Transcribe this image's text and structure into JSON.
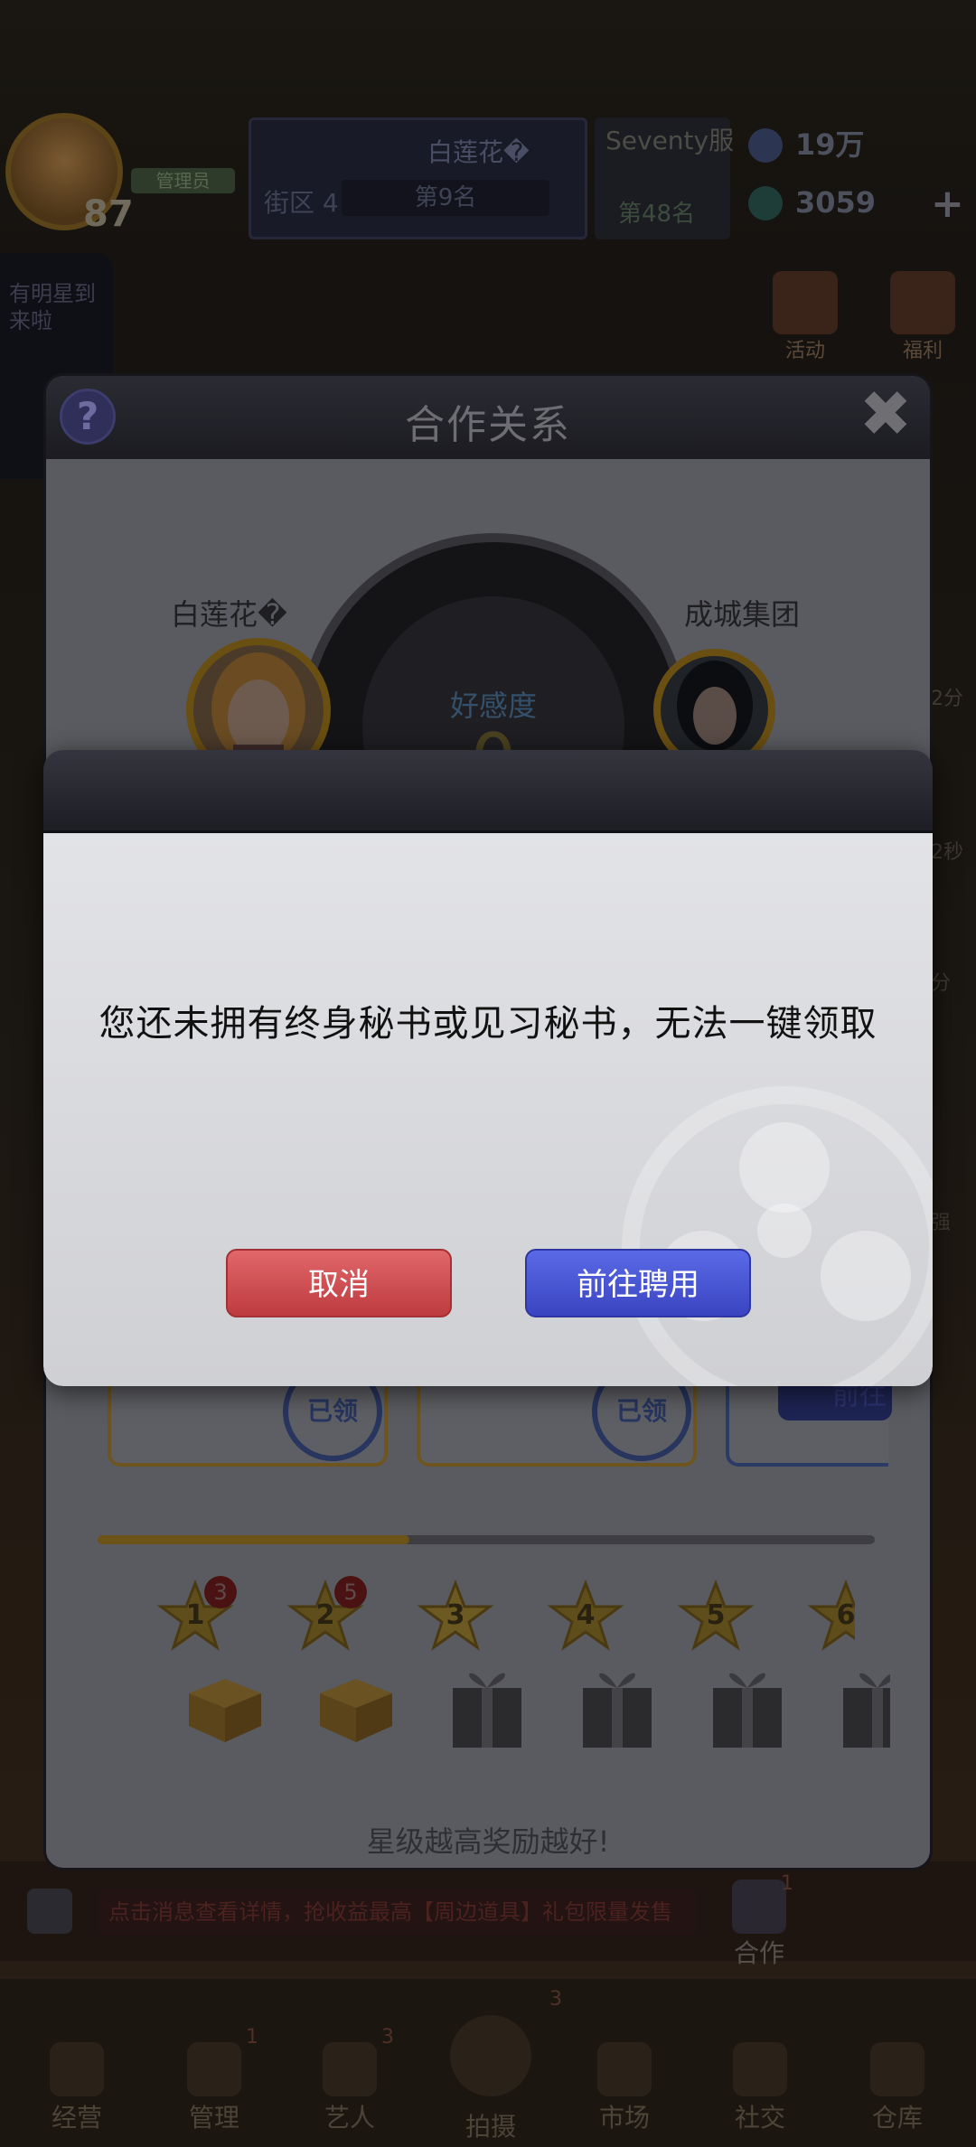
{
  "hud": {
    "level": "87",
    "vip_tag": "管理员",
    "server_rank": {
      "player_name": "白莲花�",
      "zone": "街区 4 档",
      "rank": "第9名"
    },
    "server": {
      "name": "Seventy服",
      "rank": "第48名"
    },
    "currency": {
      "coins": "19万",
      "gems": "3059",
      "add": "+"
    },
    "left_banner": "有明星到\n来啦",
    "top_icons": [
      {
        "label": "活动"
      },
      {
        "label": "福利"
      }
    ],
    "side_right": [
      "2分",
      "2秒",
      "分",
      "强"
    ],
    "bottom_banner": "点击消息查看详情，抢收益最高【周边道具】礼包限量发售",
    "coop_label": "合作",
    "coop_badge": "1",
    "tabs": [
      {
        "label": "经营",
        "badge": ""
      },
      {
        "label": "管理",
        "badge": "1"
      },
      {
        "label": "艺人",
        "badge": "3"
      },
      {
        "label": "拍摄",
        "badge": "3"
      },
      {
        "label": "市场",
        "badge": ""
      },
      {
        "label": "社交",
        "badge": ""
      },
      {
        "label": "仓库",
        "badge": ""
      }
    ]
  },
  "coop_dialog": {
    "title": "合作关系",
    "help": "?",
    "close": "✖",
    "left_name": "白莲花�",
    "right_name": "成城集团",
    "gauge_label": "好感度",
    "gauge_value": "0",
    "stamp": "已领",
    "go_button": "前往",
    "progress": 0.4,
    "stars": [
      {
        "num": "1",
        "badge": "3"
      },
      {
        "num": "2",
        "badge": "5"
      },
      {
        "num": "3",
        "badge": ""
      },
      {
        "num": "4",
        "badge": ""
      },
      {
        "num": "5",
        "badge": ""
      },
      {
        "num": "6",
        "badge": ""
      }
    ],
    "footer": "星级越高奖励越好!"
  },
  "confirm_dialog": {
    "message": "您还未拥有终身秘书或见习秘书，无法一键领取",
    "cancel_label": "取消",
    "go_label": "前往聘用"
  },
  "colors": {
    "cancel": "#cf4f53",
    "go": "#4453d2",
    "gold": "#d9a533"
  }
}
